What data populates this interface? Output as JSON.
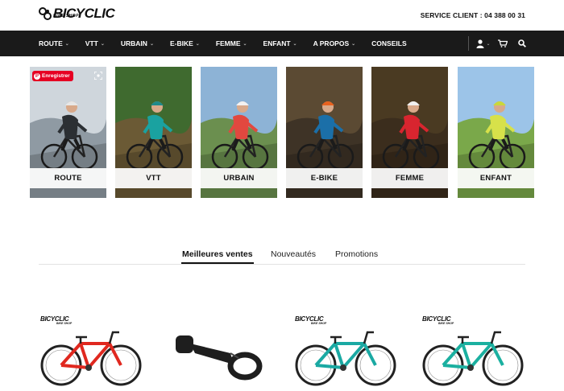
{
  "header": {
    "logo_text": "BICYCLIC",
    "logo_sub": "BIKE SHOP",
    "service_client": "SERVICE CLIENT : 04 388 00 31"
  },
  "nav": {
    "items": [
      {
        "label": "ROUTE",
        "has_caret": true
      },
      {
        "label": "VTT",
        "has_caret": true
      },
      {
        "label": "URBAIN",
        "has_caret": true
      },
      {
        "label": "E-BIKE",
        "has_caret": true
      },
      {
        "label": "FEMME",
        "has_caret": true
      },
      {
        "label": "ENFANT",
        "has_caret": true
      },
      {
        "label": "A PROPOS",
        "has_caret": true
      },
      {
        "label": "CONSEILS",
        "has_caret": false
      }
    ],
    "caret": "⌄",
    "icons": [
      "user-icon",
      "cart-icon",
      "search-icon"
    ]
  },
  "categories": [
    {
      "label": "ROUTE",
      "sky": "#cfd6dc",
      "ground": "#8f9aa3",
      "jersey": "#2b2f33",
      "helmet": "#e7e7e7"
    },
    {
      "label": "VTT",
      "sky": "#3f6a2f",
      "ground": "#6b5a35",
      "jersey": "#1aa2a0",
      "helmet": "#1f8a8a"
    },
    {
      "label": "URBAIN",
      "sky": "#8db3d6",
      "ground": "#6b8f4f",
      "jersey": "#e2483f",
      "helmet": "#f2f2f2"
    },
    {
      "label": "E-BIKE",
      "sky": "#5b4a33",
      "ground": "#3e3326",
      "jersey": "#1b6fa8",
      "helmet": "#e8621f"
    },
    {
      "label": "FEMME",
      "sky": "#4a3a22",
      "ground": "#3b2d1d",
      "jersey": "#d8252f",
      "helmet": "#f0f0f0"
    },
    {
      "label": "ENFANT",
      "sky": "#9cc4e8",
      "ground": "#7aa84a",
      "jersey": "#d7e14a",
      "helmet": "#c9d83a"
    }
  ],
  "pinterest": {
    "label": "Enregistrer"
  },
  "tabs": [
    {
      "label": "Meilleures ventes",
      "active": true
    },
    {
      "label": "Nouveautés",
      "active": false
    },
    {
      "label": "Promotions",
      "active": false
    }
  ],
  "products": [
    {
      "brand": "BICYCLIC",
      "brand_sub": "BIKE SHOP",
      "kind": "bike",
      "frame_color": "#e0281f"
    },
    {
      "brand": "",
      "brand_sub": "",
      "kind": "mount",
      "frame_color": "#1e1e1e"
    },
    {
      "brand": "BICYCLIC",
      "brand_sub": "BIKE SHOP",
      "kind": "bike",
      "frame_color": "#1aa9a3"
    },
    {
      "brand": "BICYCLIC",
      "brand_sub": "BIKE SHOP",
      "kind": "bike",
      "frame_color": "#1bb0a0"
    }
  ],
  "colors": {
    "nav_bg": "#1a1a1a",
    "pinterest": "#e60023"
  }
}
